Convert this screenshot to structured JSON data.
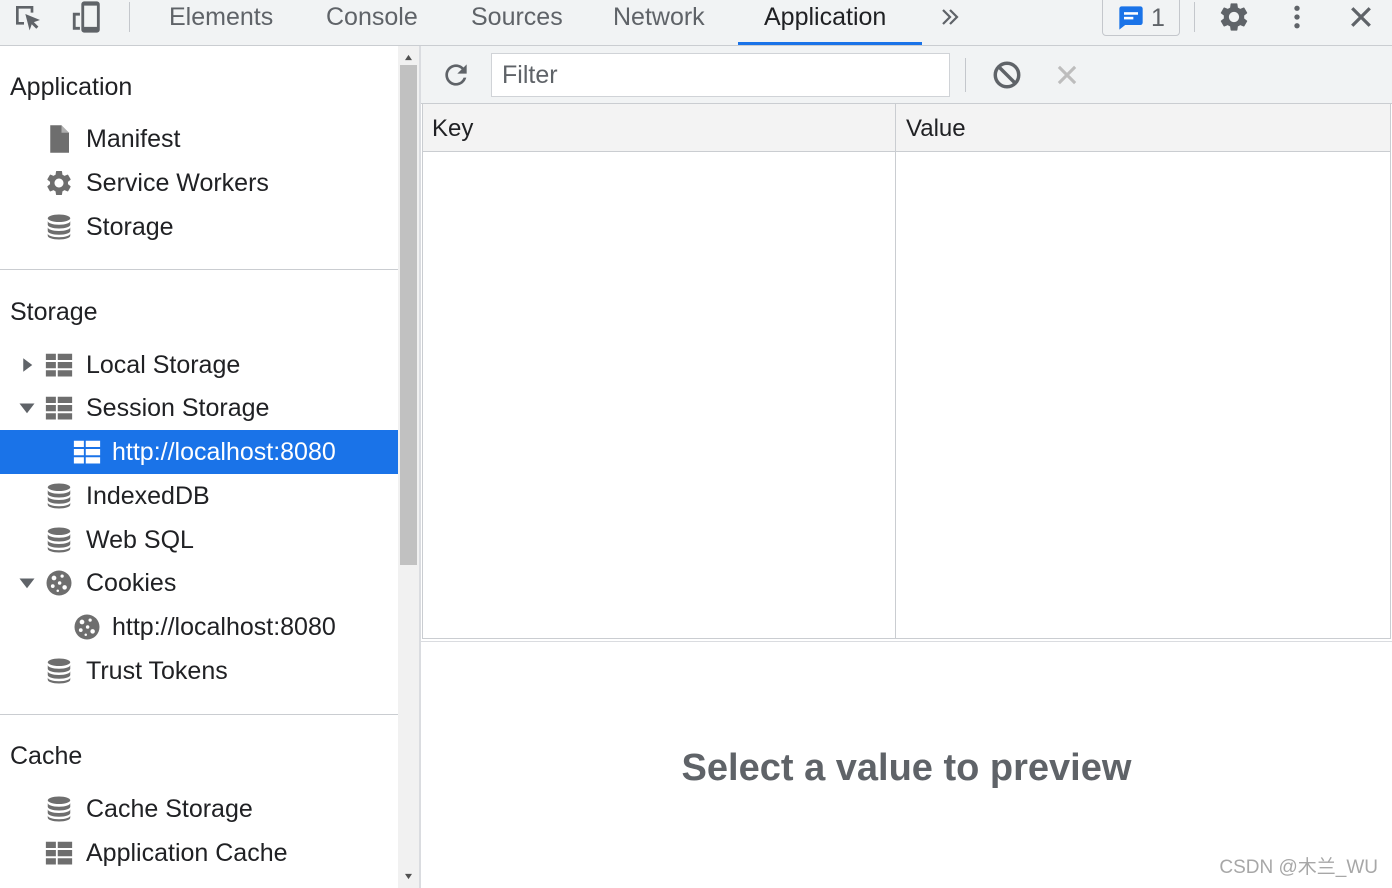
{
  "colors": {
    "accent": "#1a73e8",
    "toolbar_background": "#f1f3f4",
    "text": "#202124",
    "secondary_text": "#5f6368",
    "border": "#cacdd1",
    "icon": "#6e6e6e",
    "disabled_icon": "#bdbdbd",
    "selected_row_background": "#1a73e8",
    "selected_row_text": "#ffffff"
  },
  "topbar": {
    "left_icons": [
      "inspect-element-icon",
      "device-toolbar-icon"
    ],
    "tabs": [
      {
        "label": "Elements",
        "active": false
      },
      {
        "label": "Console",
        "active": false
      },
      {
        "label": "Sources",
        "active": false
      },
      {
        "label": "Network",
        "active": false
      },
      {
        "label": "Application",
        "active": true
      }
    ],
    "more_tabs_icon": "chevron-double-right-icon",
    "messages": {
      "icon": "message-icon",
      "count": "1"
    },
    "right_icons": [
      "gear-icon",
      "kebab-menu-icon",
      "close-icon"
    ]
  },
  "sidebar": {
    "sections": [
      {
        "title": "Application",
        "items": [
          {
            "label": "Manifest",
            "icon": "document-icon"
          },
          {
            "label": "Service Workers",
            "icon": "gear-icon"
          },
          {
            "label": "Storage",
            "icon": "database-icon"
          }
        ]
      },
      {
        "title": "Storage",
        "items": [
          {
            "label": "Local Storage",
            "icon": "table-icon",
            "expanded": false
          },
          {
            "label": "Session Storage",
            "icon": "table-icon",
            "expanded": true,
            "children": [
              {
                "label": "http://localhost:8080",
                "icon": "table-icon",
                "selected": true
              }
            ]
          },
          {
            "label": "IndexedDB",
            "icon": "database-icon"
          },
          {
            "label": "Web SQL",
            "icon": "database-icon"
          },
          {
            "label": "Cookies",
            "icon": "cookie-icon",
            "expanded": true,
            "children": [
              {
                "label": "http://localhost:8080",
                "icon": "cookie-icon",
                "selected": false
              }
            ]
          },
          {
            "label": "Trust Tokens",
            "icon": "database-icon"
          }
        ]
      },
      {
        "title": "Cache",
        "items": [
          {
            "label": "Cache Storage",
            "icon": "database-icon"
          },
          {
            "label": "Application Cache",
            "icon": "table-icon"
          }
        ]
      }
    ]
  },
  "storage_view": {
    "toolbar": {
      "refresh_icon": "refresh-icon",
      "filter": {
        "value": "",
        "placeholder": "Filter"
      },
      "clear_all_icon": "block-icon",
      "delete_selected_icon": "close-icon"
    },
    "table": {
      "columns": [
        "Key",
        "Value"
      ],
      "rows": []
    },
    "preview": {
      "message": "Select a value to preview"
    }
  },
  "watermark": "CSDN @木兰_WU"
}
